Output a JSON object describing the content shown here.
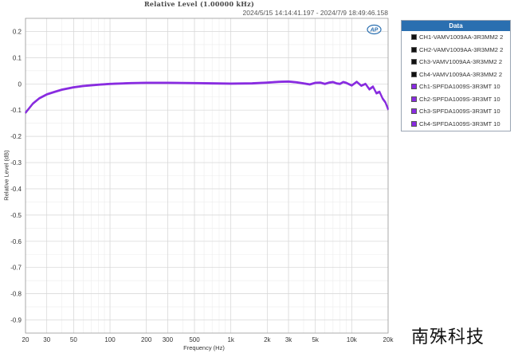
{
  "chart_data": {
    "type": "line",
    "title": "Relative Level (1.00000 kHz)",
    "timestamp": "2024/5/15 14:14:41.197 - 2024/7/9 18:49:46.158",
    "xlabel": "Frequency (Hz)",
    "ylabel": "Relative Level (dB)",
    "x_scale": "log",
    "xlim": [
      20,
      20000
    ],
    "ylim": [
      -0.95,
      0.25
    ],
    "grid": true,
    "legend_position": "right",
    "xticks": [
      {
        "value": 20,
        "label": "20"
      },
      {
        "value": 30,
        "label": "30"
      },
      {
        "value": 50,
        "label": "50"
      },
      {
        "value": 100,
        "label": "100"
      },
      {
        "value": 200,
        "label": "200"
      },
      {
        "value": 300,
        "label": "300"
      },
      {
        "value": 500,
        "label": "500"
      },
      {
        "value": 1000,
        "label": "1k"
      },
      {
        "value": 2000,
        "label": "2k"
      },
      {
        "value": 3000,
        "label": "3k"
      },
      {
        "value": 5000,
        "label": "5k"
      },
      {
        "value": 10000,
        "label": "10k"
      },
      {
        "value": 20000,
        "label": "20k"
      }
    ],
    "yticks": [
      {
        "value": 0.2,
        "label": "0.2"
      },
      {
        "value": 0.1,
        "label": "0.1"
      },
      {
        "value": 0,
        "label": "0"
      },
      {
        "value": -0.1,
        "label": "-0.1"
      },
      {
        "value": -0.2,
        "label": "-0.2"
      },
      {
        "value": -0.3,
        "label": "-0.3"
      },
      {
        "value": -0.4,
        "label": "-0.4"
      },
      {
        "value": -0.5,
        "label": "-0.5"
      },
      {
        "value": -0.6,
        "label": "-0.6"
      },
      {
        "value": -0.7,
        "label": "-0.7"
      },
      {
        "value": -0.8,
        "label": "-0.8"
      },
      {
        "value": -0.9,
        "label": "-0.9"
      }
    ],
    "x": [
      20,
      23,
      26,
      30,
      35,
      40,
      50,
      60,
      80,
      100,
      150,
      200,
      300,
      500,
      700,
      1000,
      1500,
      2000,
      2500,
      3000,
      3500,
      4000,
      4500,
      5000,
      5500,
      6000,
      6500,
      7000,
      7500,
      8000,
      8500,
      9000,
      10000,
      11000,
      12000,
      13000,
      14000,
      15000,
      16000,
      17000,
      18000,
      19000,
      20000
    ],
    "series": [
      {
        "name": "CH1-VAMV1009AA-3R3MM2 2",
        "color": "#3a2a55",
        "values": [
          -0.11,
          -0.075,
          -0.055,
          -0.04,
          -0.03,
          -0.022,
          -0.013,
          -0.008,
          -0.003,
          0.0,
          0.003,
          0.004,
          0.004,
          0.003,
          0.002,
          0.001,
          0.002,
          0.005,
          0.008,
          0.009,
          0.006,
          0.002,
          -0.002,
          0.004,
          0.005,
          0.0,
          0.005,
          0.007,
          0.002,
          0.0,
          0.007,
          0.004,
          -0.006,
          0.008,
          -0.007,
          0.0,
          -0.02,
          -0.01,
          -0.035,
          -0.03,
          -0.055,
          -0.07,
          -0.095
        ]
      },
      {
        "name": "CH2-VAMV1009AA-3R3MM2 2",
        "color": "#3a2a55",
        "values": [
          -0.112,
          -0.077,
          -0.056,
          -0.041,
          -0.031,
          -0.023,
          -0.014,
          -0.009,
          -0.004,
          -0.001,
          0.002,
          0.003,
          0.003,
          0.002,
          0.001,
          0.0,
          0.001,
          0.004,
          0.007,
          0.008,
          0.005,
          0.001,
          -0.003,
          0.003,
          0.004,
          -0.001,
          0.004,
          0.006,
          0.001,
          -0.001,
          0.006,
          0.003,
          -0.007,
          0.007,
          -0.008,
          -0.001,
          -0.022,
          -0.012,
          -0.037,
          -0.032,
          -0.057,
          -0.072,
          -0.098
        ]
      },
      {
        "name": "Ch3-VAMV1009AA-3R3MM2 2",
        "color": "#3a2a55",
        "values": [
          -0.109,
          -0.074,
          -0.054,
          -0.039,
          -0.029,
          -0.021,
          -0.012,
          -0.007,
          -0.002,
          0.001,
          0.004,
          0.005,
          0.005,
          0.004,
          0.003,
          0.002,
          0.003,
          0.006,
          0.009,
          0.01,
          0.007,
          0.003,
          -0.001,
          0.005,
          0.006,
          0.001,
          0.006,
          0.008,
          0.003,
          0.001,
          0.008,
          0.005,
          -0.005,
          0.009,
          -0.006,
          0.001,
          -0.019,
          -0.009,
          -0.034,
          -0.029,
          -0.054,
          -0.069,
          -0.094
        ]
      },
      {
        "name": "Ch4-VAMV1009AA-3R3MM2 2",
        "color": "#3a2a55",
        "values": [
          -0.111,
          -0.076,
          -0.055,
          -0.04,
          -0.03,
          -0.022,
          -0.013,
          -0.008,
          -0.003,
          0.0,
          0.003,
          0.004,
          0.004,
          0.003,
          0.002,
          0.001,
          0.002,
          0.005,
          0.008,
          0.009,
          0.006,
          0.002,
          -0.002,
          0.004,
          0.005,
          0.0,
          0.005,
          0.007,
          0.002,
          0.0,
          0.007,
          0.004,
          -0.006,
          0.008,
          -0.007,
          0.0,
          -0.021,
          -0.011,
          -0.036,
          -0.031,
          -0.056,
          -0.071,
          -0.096
        ]
      },
      {
        "name": "Ch1-SPFDA1009S-3R3MT 10",
        "color": "#8a2be2",
        "values": [
          -0.108,
          -0.073,
          -0.053,
          -0.038,
          -0.028,
          -0.02,
          -0.011,
          -0.006,
          -0.001,
          0.002,
          0.005,
          0.006,
          0.006,
          0.005,
          0.004,
          0.003,
          0.004,
          0.007,
          0.01,
          0.011,
          0.008,
          0.004,
          0.0,
          0.006,
          0.007,
          0.002,
          0.007,
          0.009,
          0.004,
          0.002,
          0.009,
          0.006,
          -0.004,
          0.01,
          -0.005,
          0.002,
          -0.018,
          -0.008,
          -0.033,
          -0.028,
          -0.053,
          -0.068,
          -0.093
        ]
      },
      {
        "name": "Ch2-SPFDA1009S-3R3MT 10",
        "color": "#8a2be2",
        "values": [
          -0.11,
          -0.075,
          -0.055,
          -0.04,
          -0.03,
          -0.022,
          -0.013,
          -0.008,
          -0.003,
          0.0,
          0.003,
          0.004,
          0.004,
          0.003,
          0.002,
          0.001,
          0.002,
          0.005,
          0.008,
          0.009,
          0.006,
          0.002,
          -0.002,
          0.004,
          0.005,
          0.0,
          0.005,
          0.007,
          0.002,
          0.0,
          0.007,
          0.004,
          -0.006,
          0.008,
          -0.007,
          0.0,
          -0.02,
          -0.01,
          -0.035,
          -0.03,
          -0.055,
          -0.07,
          -0.095
        ]
      },
      {
        "name": "Ch3-SPFDA1009S-3R3MT 10",
        "color": "#8a2be2",
        "values": [
          -0.112,
          -0.077,
          -0.057,
          -0.042,
          -0.032,
          -0.024,
          -0.015,
          -0.01,
          -0.005,
          -0.002,
          0.001,
          0.002,
          0.002,
          0.001,
          0.0,
          -0.001,
          0.0,
          0.003,
          0.006,
          0.007,
          0.004,
          0.0,
          -0.004,
          0.002,
          0.003,
          -0.002,
          0.003,
          0.005,
          0.0,
          -0.002,
          0.005,
          0.002,
          -0.008,
          0.006,
          -0.009,
          -0.002,
          -0.023,
          -0.013,
          -0.038,
          -0.033,
          -0.058,
          -0.073,
          -0.1
        ]
      },
      {
        "name": "Ch4-SPFDA1009S-3R3MT 10",
        "color": "#8a2be2",
        "values": [
          -0.109,
          -0.074,
          -0.054,
          -0.039,
          -0.029,
          -0.021,
          -0.012,
          -0.007,
          -0.002,
          0.001,
          0.004,
          0.005,
          0.005,
          0.004,
          0.003,
          0.002,
          0.003,
          0.006,
          0.009,
          0.01,
          0.007,
          0.003,
          -0.001,
          0.005,
          0.006,
          0.001,
          0.006,
          0.008,
          0.003,
          0.001,
          0.008,
          0.005,
          -0.005,
          0.009,
          -0.006,
          0.001,
          -0.019,
          -0.009,
          -0.034,
          -0.029,
          -0.054,
          -0.069,
          -0.094
        ]
      }
    ]
  },
  "legend": {
    "header": "Data",
    "items": [
      {
        "label": "CH1-VAMV1009AA-3R3MM2 2",
        "color": "#111111"
      },
      {
        "label": "CH2-VAMV1009AA-3R3MM2 2",
        "color": "#111111"
      },
      {
        "label": "Ch3-VAMV1009AA-3R3MM2 2",
        "color": "#111111"
      },
      {
        "label": "Ch4-VAMV1009AA-3R3MM2 2",
        "color": "#111111"
      },
      {
        "label": "Ch1-SPFDA1009S-3R3MT 10",
        "color": "#8a2be2"
      },
      {
        "label": "Ch2-SPFDA1009S-3R3MT 10",
        "color": "#8a2be2"
      },
      {
        "label": "Ch3-SPFDA1009S-3R3MT 10",
        "color": "#8a2be2"
      },
      {
        "label": "Ch4-SPFDA1009S-3R3MT 10",
        "color": "#8a2be2"
      }
    ]
  },
  "logo": {
    "icon": "ap-logo-icon",
    "text": "AP"
  },
  "watermark": "南殊科技"
}
